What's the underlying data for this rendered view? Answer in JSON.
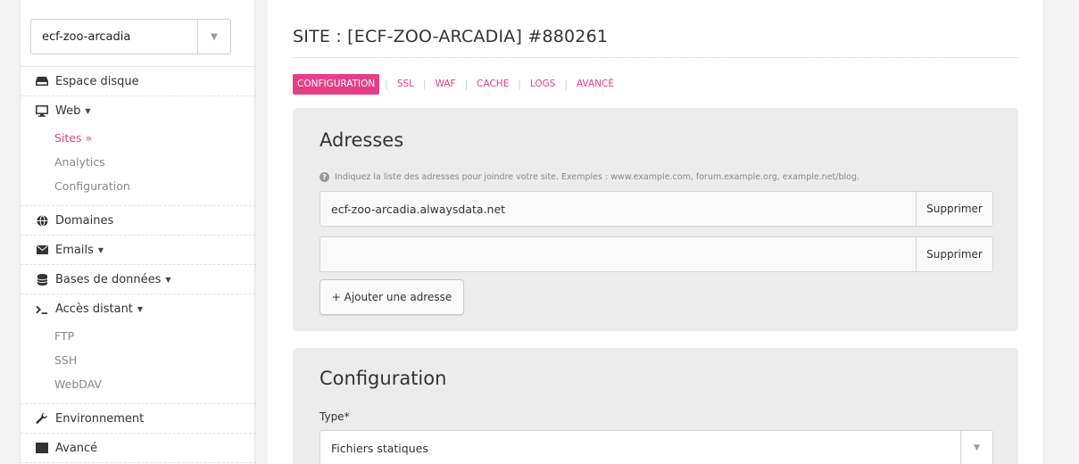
{
  "account": {
    "selected": "ecf-zoo-arcadia"
  },
  "sidebar": {
    "disk": "Espace disque",
    "web": {
      "label": "Web",
      "items": [
        "Sites »",
        "Analytics",
        "Configuration"
      ]
    },
    "domains": "Domaines",
    "emails": "Emails",
    "databases": "Bases de données",
    "remote": {
      "label": "Accès distant",
      "items": [
        "FTP",
        "SSH",
        "WebDAV"
      ]
    },
    "environment": "Environnement",
    "advanced": "Avancé"
  },
  "page": {
    "title": "SITE : [ECF-ZOO-ARCADIA] #880261"
  },
  "tabs": [
    "CONFIGURATION",
    "SSL",
    "WAF",
    "CACHE",
    "LOGS",
    "AVANCÉ"
  ],
  "addresses": {
    "title": "Adresses",
    "help": "Indiquez la liste des adresses pour joindre votre site. Exemples : www.example.com, forum.example.org, example.net/blog.",
    "values": [
      "ecf-zoo-arcadia.alwaysdata.net",
      ""
    ],
    "delete_label": "Supprimer",
    "add_label": "+ Ajouter une adresse"
  },
  "configuration": {
    "title": "Configuration",
    "type_label": "Type*",
    "type_value": "Fichiers statiques"
  },
  "colors": {
    "accent": "#e63f86",
    "card_bg": "#ececec"
  }
}
